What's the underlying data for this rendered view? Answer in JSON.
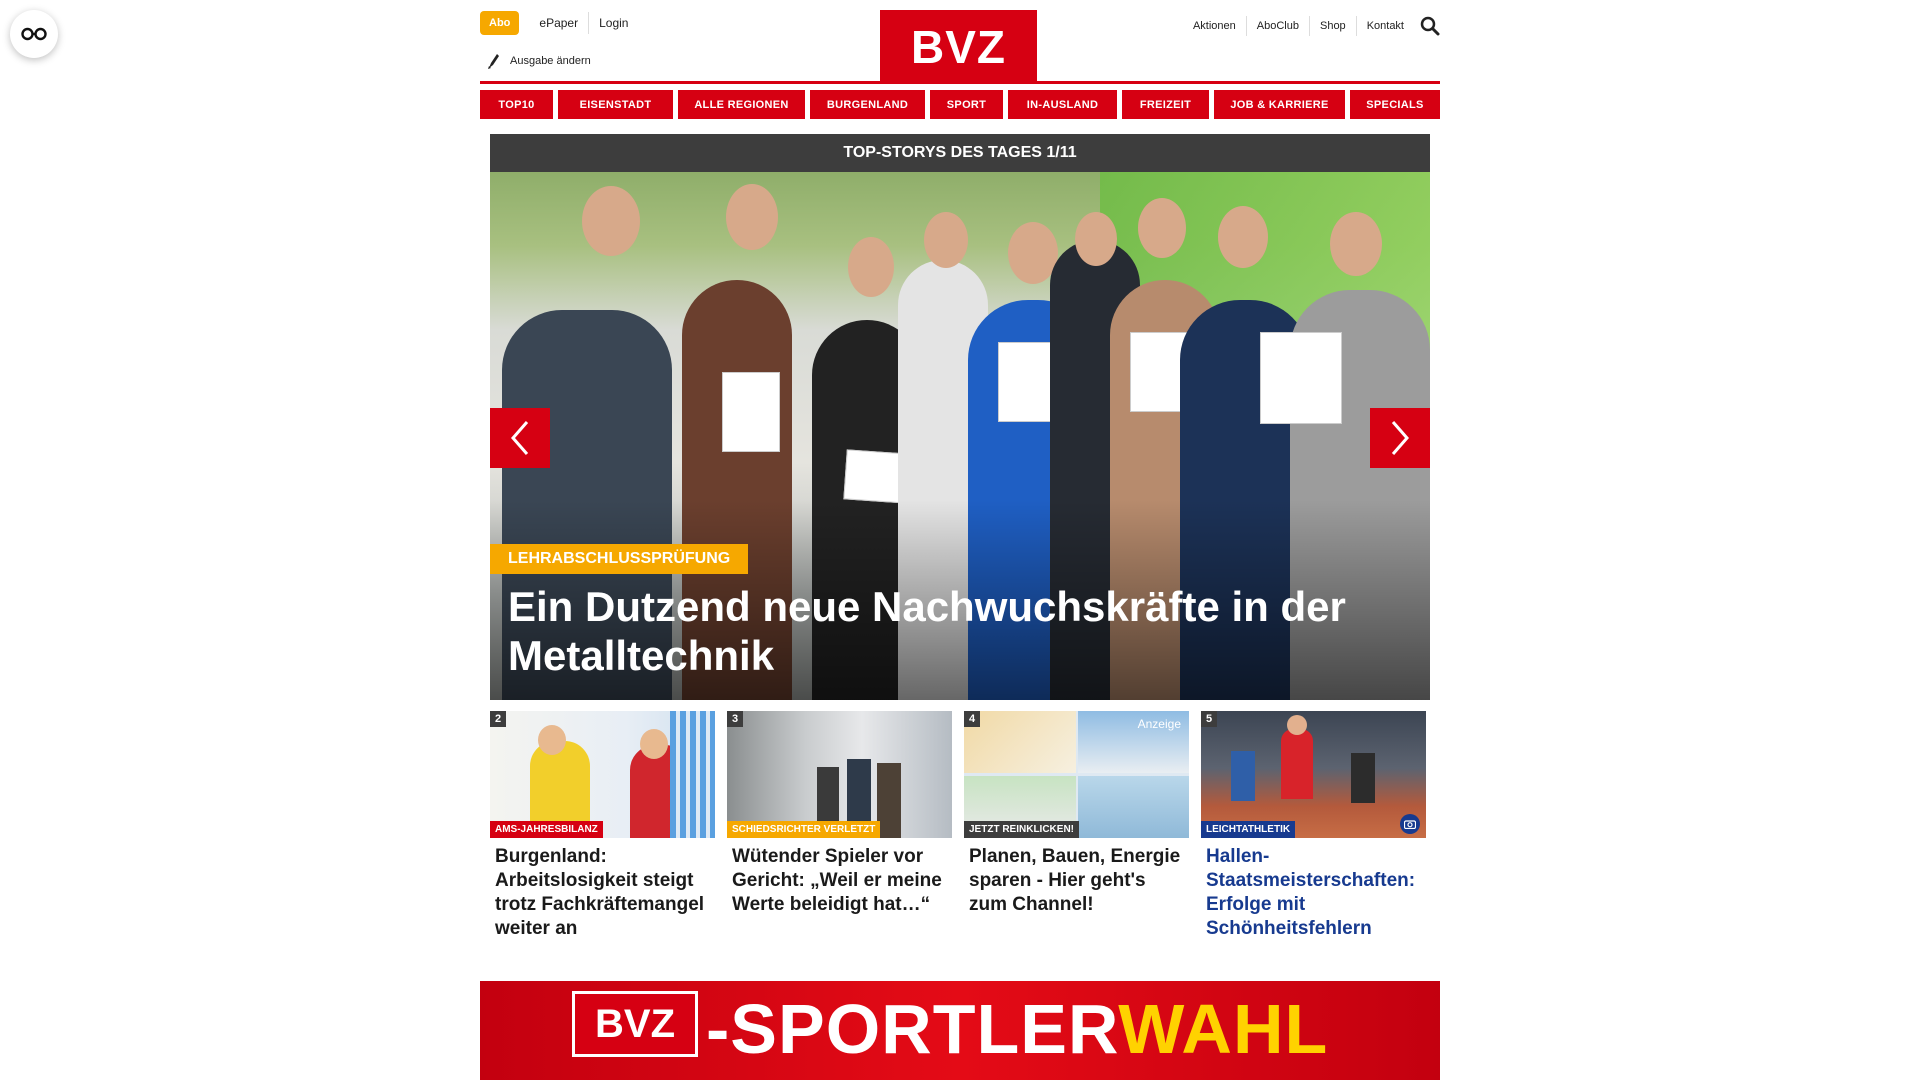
{
  "accessibility": {
    "icon": "reading-glasses-icon"
  },
  "header": {
    "abo_label": "Abo",
    "epaper_label": "ePaper",
    "login_label": "Login",
    "ausgabe_label": "Ausgabe ändern",
    "logo_text": "BVZ",
    "right_links": [
      "Aktionen",
      "AboClub",
      "Shop",
      "Kontakt"
    ],
    "search_icon": "search-icon",
    "brand_color": "#d60012",
    "accent_color": "#f6a800"
  },
  "nav": {
    "items": [
      "TOP10",
      "EISENSTADT",
      "ALLE REGIONEN",
      "BURGENLAND",
      "SPORT",
      "IN-AUSLAND",
      "FREIZEIT",
      "JOB & KARRIERE",
      "SPECIALS"
    ]
  },
  "carousel": {
    "heading": "TOP-STORYS DES TAGES 1/11",
    "tag": "LEHRABSCHLUSSPRÜFUNG",
    "title": "Ein Dutzend neue Nachwuchskräfte in der Metalltechnik",
    "prev_icon": "chevron-left-icon",
    "next_icon": "chevron-right-icon"
  },
  "cards": [
    {
      "num": "2",
      "tag": "AMS-JAHRESBILANZ",
      "tag_color": "#d60012",
      "title": "Burgenland: Arbeitslosigkeit steigt trotz Fachkräftemangel weiter an",
      "blue": false
    },
    {
      "num": "3",
      "tag": "SCHIEDSRICHTER VERLETZT",
      "tag_color": "#f6a800",
      "title": "Wütender Spieler vor Gericht: „Weil er meine Werte beleidigt hat…“",
      "blue": false
    },
    {
      "num": "4",
      "tag": "JETZT REINKLICKEN!",
      "tag_color": "#3d3d3d",
      "title": "Planen, Bauen, Energie sparen - Hier geht's zum Channel!",
      "anzeige": "Anzeige",
      "blue": false
    },
    {
      "num": "5",
      "tag": "LEICHTATHLETIK",
      "tag_color": "#173a8f",
      "title": "Hallen-Staatsmeisterschaften: Erfolge mit Schönheitsfehlern",
      "blue": true
    }
  ],
  "banner": {
    "logo_text": "BVZ",
    "text_white": "-SPORTLER",
    "text_yellow": "WAHL"
  }
}
